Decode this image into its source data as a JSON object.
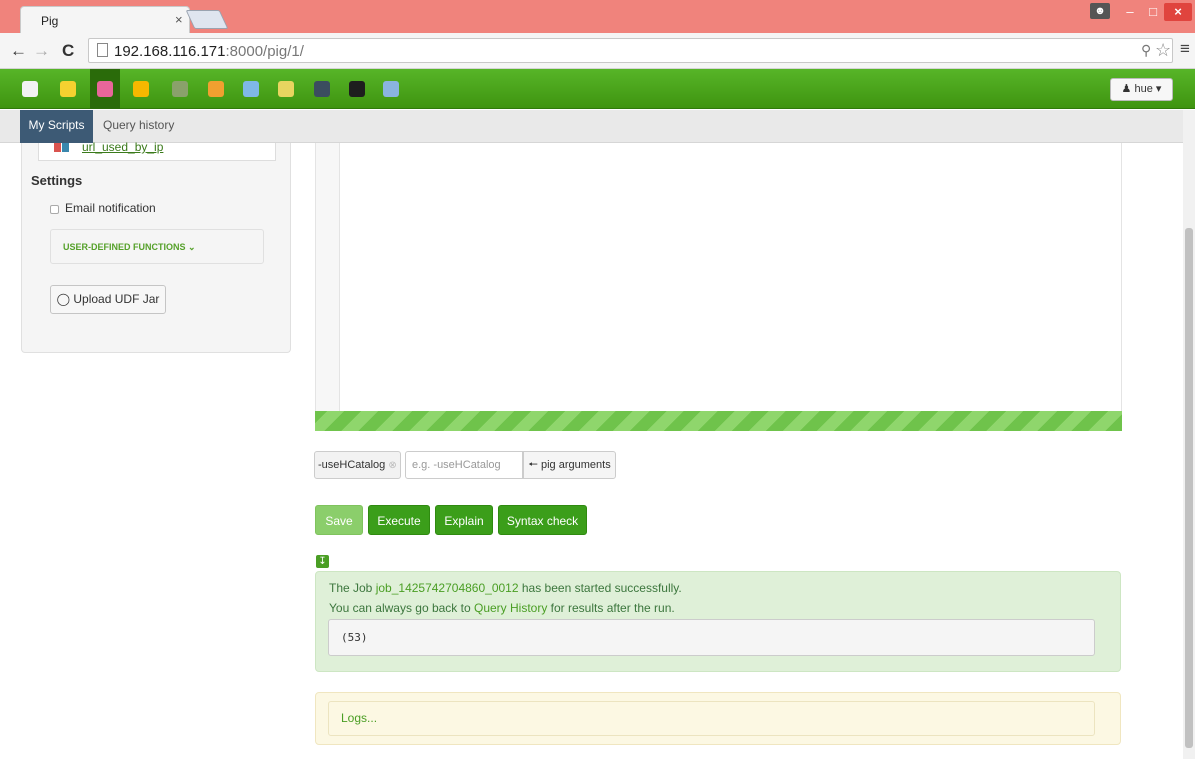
{
  "browser": {
    "tab_title": "Pig",
    "tab_close": "×",
    "url_host": "192.168.116.171",
    "url_rest": ":8000/pig/1/",
    "window_controls": {
      "minimize": "–",
      "maximize": "□",
      "close": "×"
    }
  },
  "hue_nav": {
    "apps": [
      {
        "icon": "hue-logo-icon",
        "color": "#f2f2f2"
      },
      {
        "icon": "beeswax-icon",
        "color": "#f5d130"
      },
      {
        "icon": "pig-icon",
        "color": "#e8669a"
      },
      {
        "icon": "hcat-icon",
        "color": "#f5b800"
      },
      {
        "icon": "jobsub-icon",
        "color": "#8aa16b"
      },
      {
        "icon": "impala-icon",
        "color": "#f0a030"
      },
      {
        "icon": "filebrowser-icon",
        "color": "#7fb8e6"
      },
      {
        "icon": "oozie-icon",
        "color": "#e8d560"
      },
      {
        "icon": "shell-icon",
        "color": "#3b4d5f"
      },
      {
        "icon": "user-admin-icon",
        "color": "#1e1e1e"
      },
      {
        "icon": "help-icon",
        "color": "#8ab4e0"
      }
    ],
    "user_label": "hue",
    "user_caret": "▾"
  },
  "subnav": {
    "tabs": [
      {
        "label": "My Scripts",
        "active": true
      },
      {
        "label": "Query history",
        "active": false
      }
    ]
  },
  "sidebar": {
    "script_name": "url_used_by_ip",
    "settings_title": "Settings",
    "email_notification_label": "Email notification",
    "udf_label": "USER-DEFINED FUNCTIONS",
    "upload_label": "Upload UDF Jar"
  },
  "arguments": {
    "tag": "-useHCatalog",
    "input_placeholder": "e.g. -useHCatalog",
    "button_label": "pig arguments"
  },
  "actions": {
    "save": "Save",
    "execute": "Execute",
    "explain": "Explain",
    "syntax_check": "Syntax check"
  },
  "result": {
    "line1_prefix": "The Job ",
    "job_id": "job_1425742704860_0012",
    "line1_suffix": " has been started successfully.",
    "line2_prefix": "You can always go back to ",
    "query_history_link": "Query History",
    "line2_suffix": " for results after the run.",
    "output": "(53)",
    "logs": "Logs..."
  },
  "colors": {
    "nav_green": "#4ca51c",
    "active_tab": "#3d5a75",
    "button_green": "#3b9e1a",
    "success_bg": "#dff0d8",
    "warning_bg": "#fcf8e3"
  }
}
